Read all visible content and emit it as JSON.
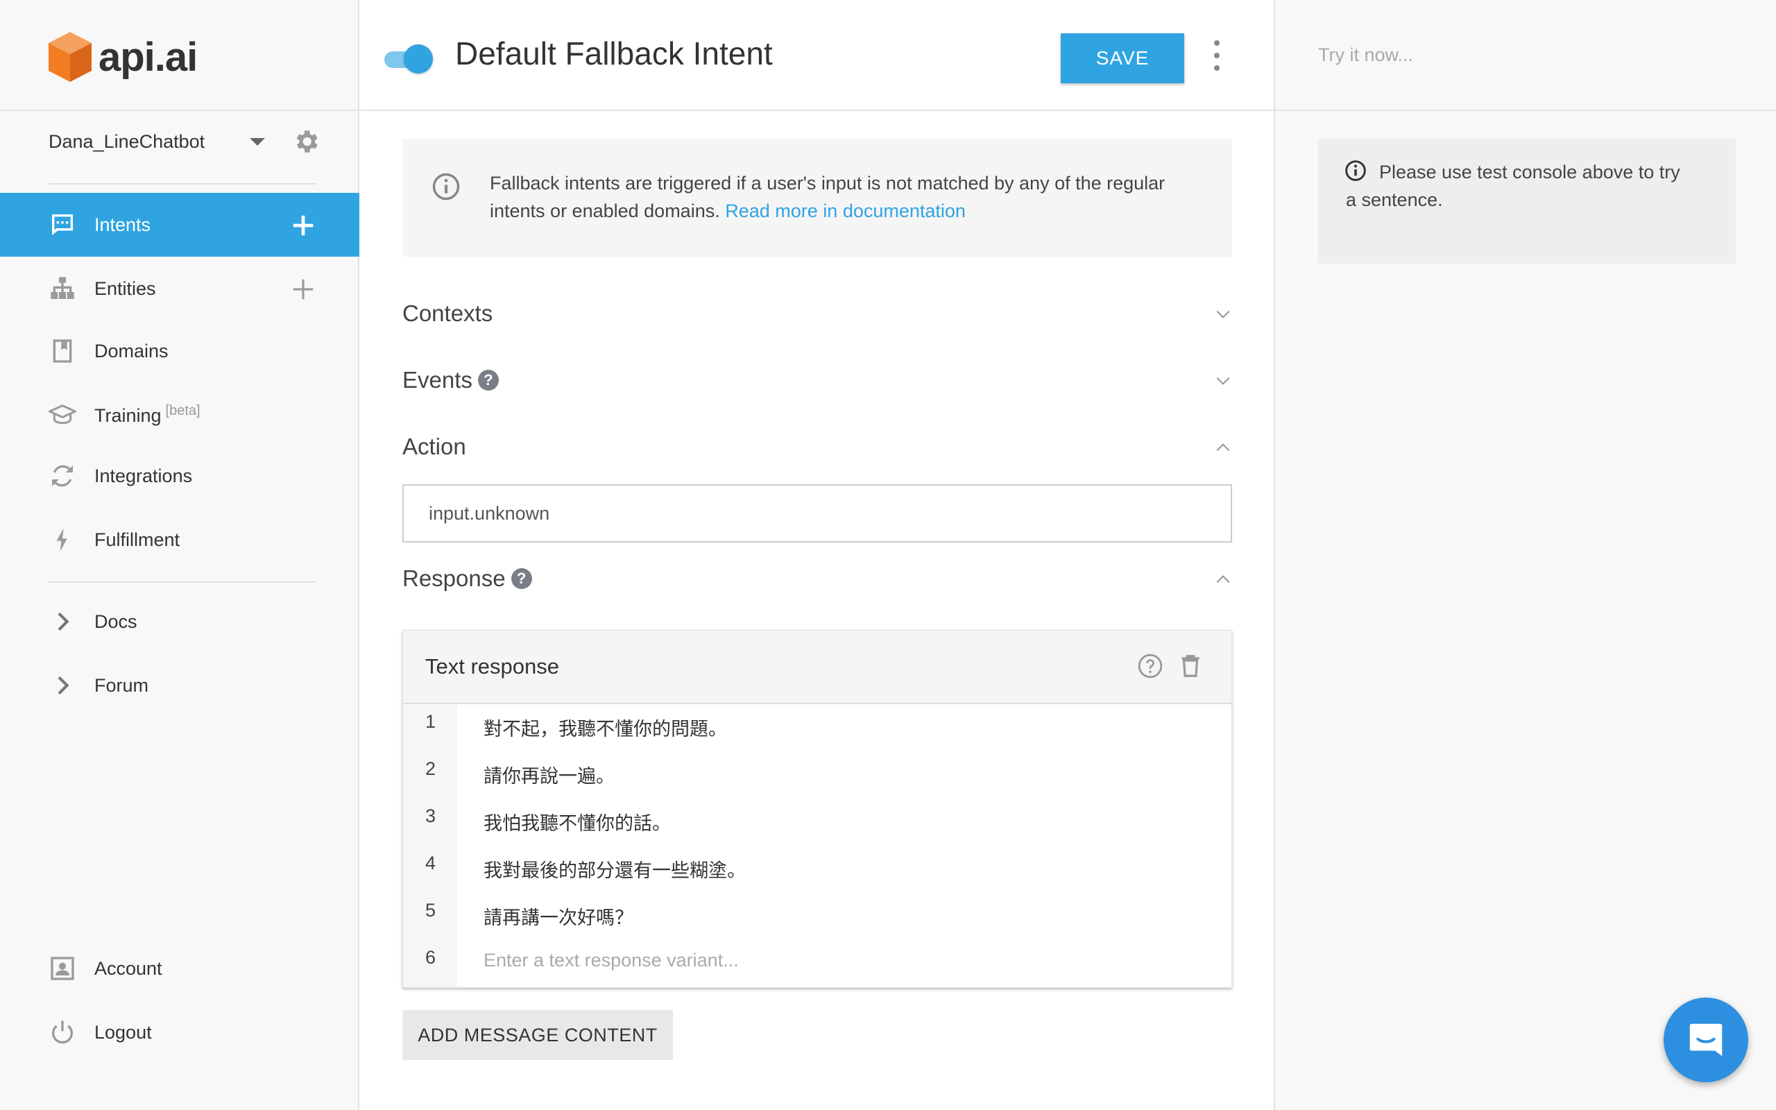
{
  "app": {
    "logo_text": "api.ai",
    "brand_color": "#f27c22",
    "accent_color": "#2fa4e1"
  },
  "sidebar": {
    "agent_name": "Dana_LineChatbot",
    "nav_items": [
      {
        "label": "Intents",
        "icon": "chat-icon",
        "active": true
      },
      {
        "label": "Entities",
        "icon": "hierarchy-icon"
      },
      {
        "label": "Domains",
        "icon": "book-icon"
      },
      {
        "label": "Training",
        "icon": "graduation-cap-icon",
        "badge": "[beta]"
      },
      {
        "label": "Integrations",
        "icon": "refresh-icon"
      },
      {
        "label": "Fulfillment",
        "icon": "bolt-icon"
      }
    ],
    "links": [
      {
        "label": "Docs",
        "icon": "chevron-right-icon"
      },
      {
        "label": "Forum",
        "icon": "chevron-right-icon"
      }
    ],
    "bottom": [
      {
        "label": "Account",
        "icon": "account-icon"
      },
      {
        "label": "Logout",
        "icon": "power-icon"
      }
    ]
  },
  "header": {
    "intent_enabled": true,
    "title": "Default Fallback Intent",
    "save_label": "SAVE"
  },
  "main": {
    "info_text": "Fallback intents are triggered if a user's input is not matched by any of the regular intents or enabled domains.",
    "info_link": "Read more in documentation",
    "sections": {
      "contexts": "Contexts",
      "events": "Events",
      "action": "Action",
      "response": "Response"
    },
    "help_mark": "?",
    "action_value": "input.unknown",
    "text_response": {
      "title": "Text response",
      "lines": [
        {
          "num": "1",
          "text": "對不起，我聽不懂你的問題。"
        },
        {
          "num": "2",
          "text": "請你再說一遍。"
        },
        {
          "num": "3",
          "text": "我怕我聽不懂你的話。"
        },
        {
          "num": "4",
          "text": "我對最後的部分還有一些糊塗。"
        },
        {
          "num": "5",
          "text": "請再講一次好嗎？"
        }
      ],
      "new_line_num": "6",
      "new_line_placeholder": "Enter a text response variant..."
    },
    "add_message_label": "ADD MESSAGE CONTENT"
  },
  "console": {
    "placeholder": "Try it now...",
    "info_text": "Please use test console above to try a sentence."
  }
}
